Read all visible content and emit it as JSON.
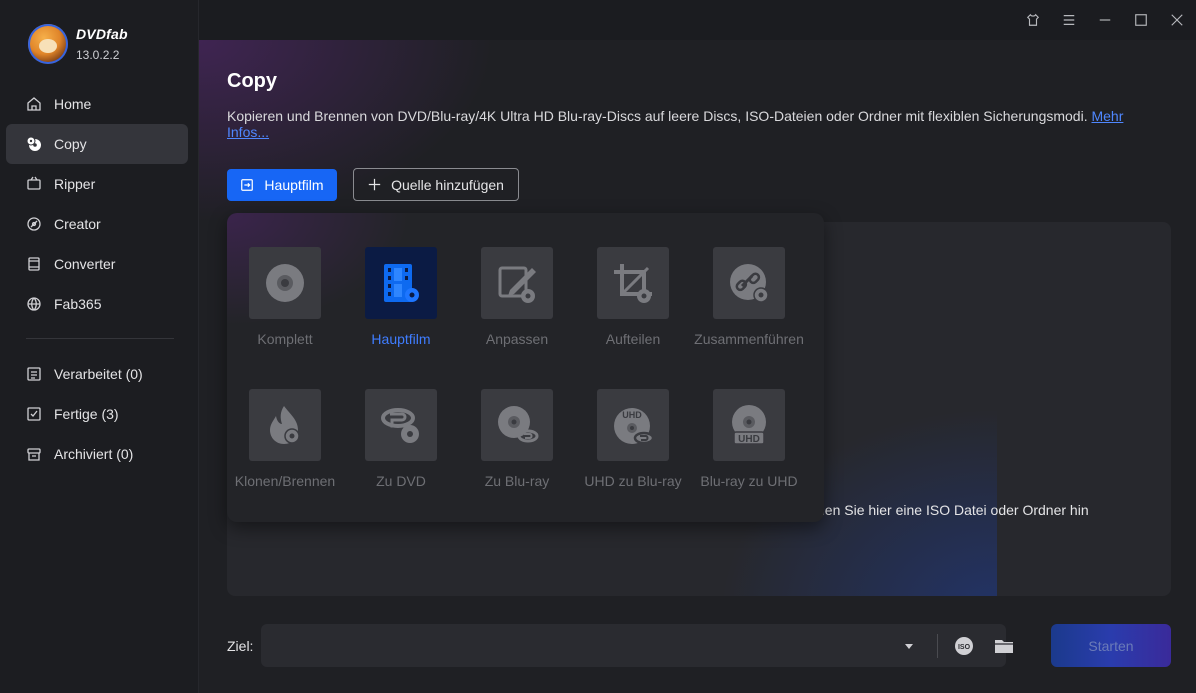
{
  "app": {
    "name": "DVDfab",
    "version": "13.0.2.2"
  },
  "sidebar": {
    "items": [
      {
        "label": "Home",
        "icon": "home-icon"
      },
      {
        "label": "Copy",
        "icon": "copy-disc-icon",
        "active": true
      },
      {
        "label": "Ripper",
        "icon": "ripper-icon"
      },
      {
        "label": "Creator",
        "icon": "creator-icon"
      },
      {
        "label": "Converter",
        "icon": "converter-icon"
      },
      {
        "label": "Fab365",
        "icon": "fab365-icon"
      }
    ],
    "queue": [
      {
        "label": "Verarbeitet (0)",
        "icon": "processing-list-icon"
      },
      {
        "label": "Fertige (3)",
        "icon": "finished-icon"
      },
      {
        "label": "Archiviert (0)",
        "icon": "archive-icon"
      }
    ]
  },
  "titlebar": {
    "icons": [
      "skin-icon",
      "menu-icon",
      "minimize-icon",
      "maximize-icon",
      "close-icon"
    ]
  },
  "main": {
    "title": "Copy",
    "description": "Kopieren und Brennen von DVD/Blu-ray/4K Ultra HD Blu-ray-Discs auf leere Discs, ISO-Dateien oder Ordner mit flexiblen Sicherungsmodi.",
    "more_link": "Mehr Infos...",
    "mode_button": "Hauptfilm",
    "add_source_button": "Quelle hinzufügen",
    "drop_hint": "hen Sie hier eine ISO Datei oder Ordner hin"
  },
  "modes": [
    {
      "label": "Komplett",
      "icon": "disc-icon"
    },
    {
      "label": "Hauptfilm",
      "icon": "film-icon",
      "active": true
    },
    {
      "label": "Anpassen",
      "icon": "edit-icon"
    },
    {
      "label": "Aufteilen",
      "icon": "crop-icon"
    },
    {
      "label": "Zusammenführen",
      "icon": "link-icon"
    },
    {
      "label": "Klonen/Brennen",
      "icon": "flame-icon"
    },
    {
      "label": "Zu DVD",
      "icon": "bluray-to-dvd-icon"
    },
    {
      "label": "Zu Blu-ray",
      "icon": "to-bluray-icon"
    },
    {
      "label": "UHD zu Blu-ray",
      "icon": "uhd-to-bluray-icon"
    },
    {
      "label": "Blu-ray zu UHD",
      "icon": "bluray-to-uhd-icon"
    }
  ],
  "bottom": {
    "ziel_label": "Ziel:",
    "ziel_value": "",
    "iso_label": "ISO",
    "start_button": "Starten"
  },
  "colors": {
    "accent": "#1766f5",
    "active_label": "#3f7dff",
    "sidebar_bg": "#1c1d21",
    "main_bg": "#1f2024"
  }
}
